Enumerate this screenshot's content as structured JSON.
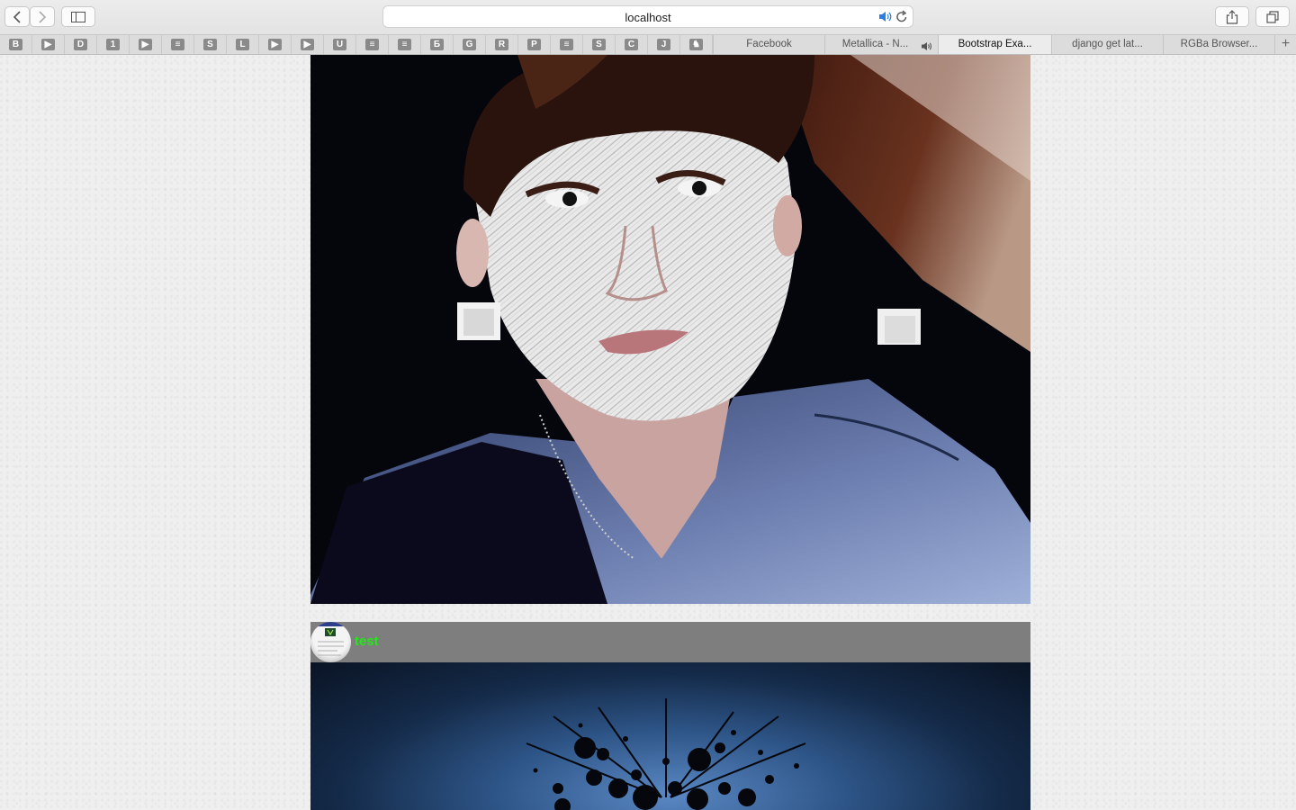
{
  "browser": {
    "address": {
      "url": "localhost"
    },
    "pinned_tabs": [
      {
        "glyph": "B"
      },
      {
        "glyph": "▶"
      },
      {
        "glyph": "D"
      },
      {
        "glyph": "1"
      },
      {
        "glyph": "▶"
      },
      {
        "glyph": "≡"
      },
      {
        "glyph": "S"
      },
      {
        "glyph": "L"
      },
      {
        "glyph": "▶"
      },
      {
        "glyph": "▶"
      },
      {
        "glyph": "U"
      },
      {
        "glyph": "≡"
      },
      {
        "glyph": "≡"
      },
      {
        "glyph": "Б"
      },
      {
        "glyph": "G"
      },
      {
        "glyph": "R"
      },
      {
        "glyph": "P"
      },
      {
        "glyph": "≡"
      },
      {
        "glyph": "S"
      },
      {
        "glyph": "C"
      },
      {
        "glyph": "J"
      },
      {
        "glyph": "♞"
      }
    ],
    "tabs": [
      {
        "label": "Facebook",
        "active": false
      },
      {
        "label": "Metallica - N...",
        "active": false,
        "audio": true
      },
      {
        "label": "Bootstrap Exa...",
        "active": true
      },
      {
        "label": "django get lat...",
        "active": false
      },
      {
        "label": "RGBa Browser...",
        "active": false
      }
    ],
    "new_tab_label": "+"
  },
  "feed": {
    "post": {
      "username": "test"
    }
  }
}
